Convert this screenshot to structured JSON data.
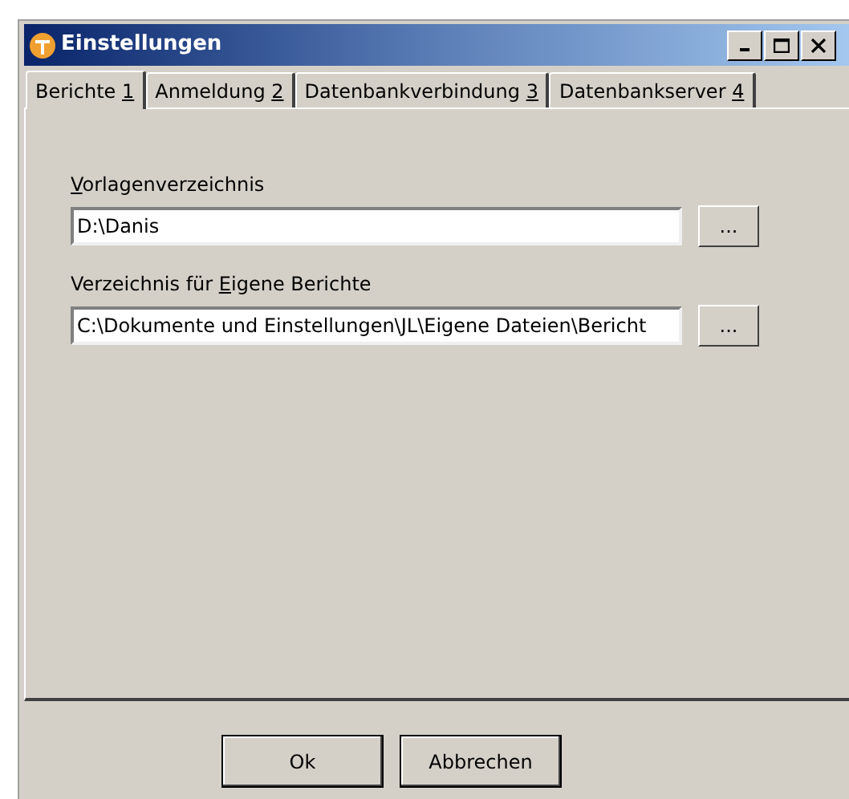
{
  "window": {
    "title": "Einstellungen"
  },
  "tabs": [
    {
      "before": "Berichte ",
      "underlined": "1",
      "selected": true
    },
    {
      "before": "Anmeldung ",
      "underlined": "2",
      "selected": false
    },
    {
      "before": "Datenbankverbindung ",
      "underlined": "3",
      "selected": false
    },
    {
      "before": "Datenbankserver ",
      "underlined": "4",
      "selected": false
    }
  ],
  "fields": [
    {
      "label": {
        "underlined": "V",
        "after": "orlagenverzeichnis"
      },
      "value": "D:\\Danis",
      "browse": "..."
    },
    {
      "label": {
        "before": "Verzeichnis für ",
        "underlined": "E",
        "after": "igene Berichte"
      },
      "value": "C:\\Dokumente und Einstellungen\\JL\\Eigene Dateien\\Bericht",
      "browse": "..."
    }
  ],
  "buttons": [
    "Ok",
    "Abbrechen"
  ]
}
